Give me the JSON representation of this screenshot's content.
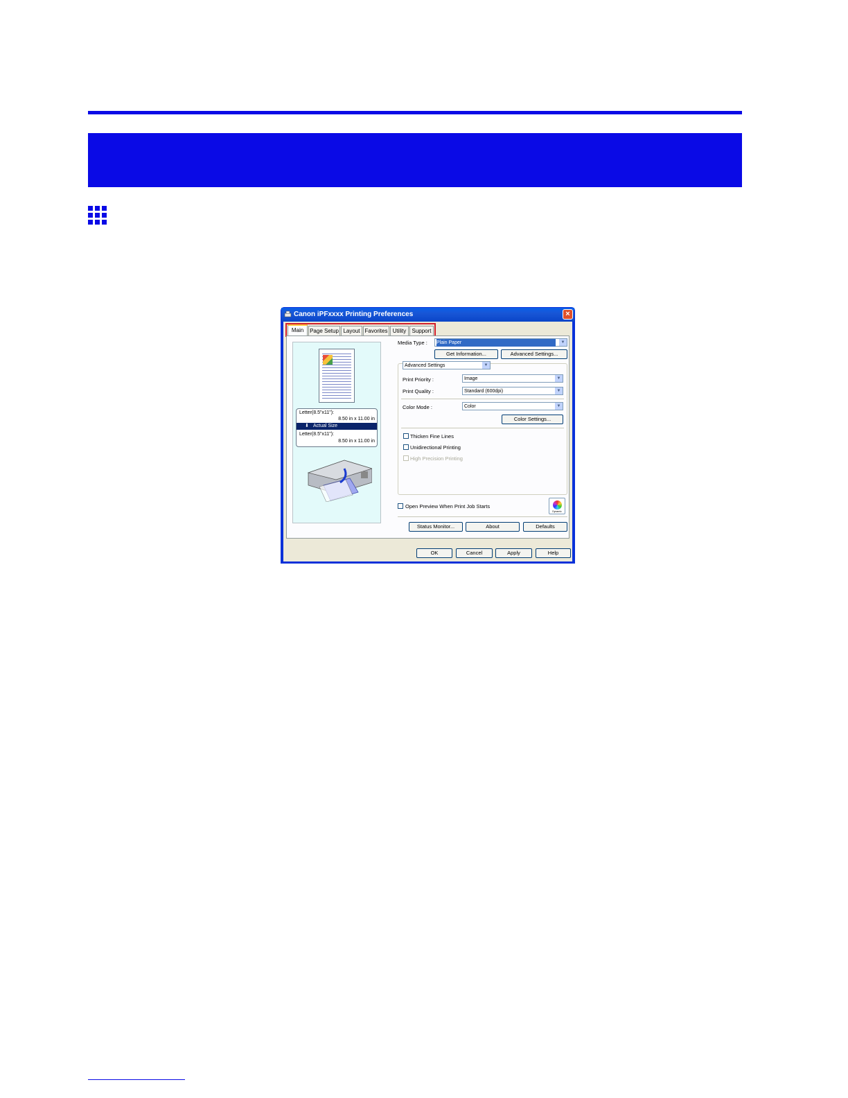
{
  "dialog": {
    "title": "Canon iPFxxxx Printing Preferences",
    "close_label": "×",
    "tabs": [
      {
        "label": "Main"
      },
      {
        "label": "Page Setup"
      },
      {
        "label": "Layout"
      },
      {
        "label": "Favorites"
      },
      {
        "label": "Utility"
      },
      {
        "label": "Support"
      }
    ],
    "preview": {
      "original_size": "Letter(8.5\"x11\"):",
      "original_dims": "8.50 in x 11.00 in",
      "scaling": "Actual Size",
      "output_size": "Letter(8.5\"x11\"):",
      "output_dims": "8.50 in x 11.00 in"
    },
    "media_type": {
      "label": "Media Type :",
      "value": "Plain Paper"
    },
    "get_information_label": "Get Information...",
    "advanced_settings_button_label": "Advanced Settings...",
    "settings_mode": {
      "value": "Advanced Settings"
    },
    "print_priority": {
      "label": "Print Priority :",
      "value": "Image"
    },
    "print_quality": {
      "label": "Print Quality :",
      "value": "Standard (600dpi)"
    },
    "color_mode": {
      "label": "Color Mode :",
      "value": "Color"
    },
    "color_settings_label": "Color Settings...",
    "thicken_fine_lines_label": "Thicken Fine Lines",
    "unidirectional_printing_label": "Unidirectional Printing",
    "high_precision_printing_label": "High Precision Printing",
    "open_preview_label": "Open Preview When Print Job Starts",
    "color_icon_text": "Dynamic",
    "status_monitor_label": "Status Monitor...",
    "about_label": "About",
    "defaults_label": "Defaults",
    "ok_label": "OK",
    "cancel_label": "Cancel",
    "apply_label": "Apply",
    "help_label": "Help"
  },
  "colors": {
    "accent_blue": "#0a0ae6",
    "highlight_red": "#d21f2b",
    "titlebar": "#0a5fe8"
  }
}
